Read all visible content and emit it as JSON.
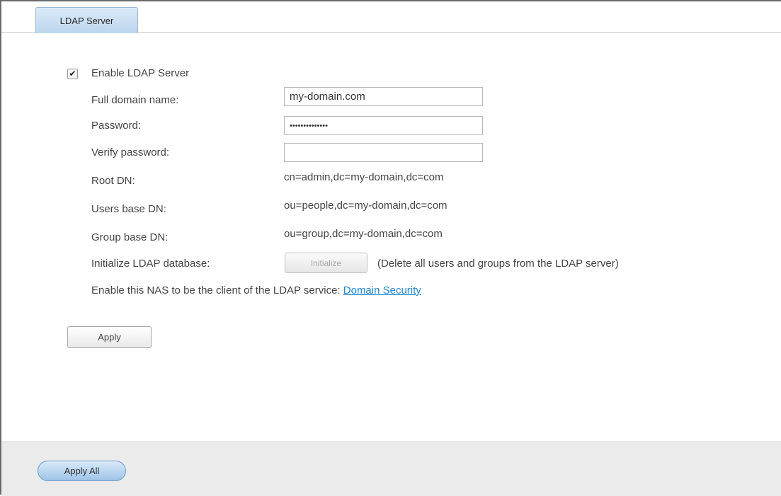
{
  "tabs": [
    {
      "label": "LDAP Server",
      "active": true
    }
  ],
  "form": {
    "enable": {
      "label": "Enable LDAP Server",
      "checked": true
    },
    "full_domain_name": {
      "label": "Full domain name:",
      "value": "my-domain.com"
    },
    "password": {
      "label": "Password:",
      "value": "••••••••••••••"
    },
    "verify_password": {
      "label": "Verify password:",
      "value": ""
    },
    "root_dn": {
      "label": "Root DN:",
      "value": "cn=admin,dc=my-domain,dc=com"
    },
    "users_base_dn": {
      "label": "Users base DN:",
      "value": "ou=people,dc=my-domain,dc=com"
    },
    "group_base_dn": {
      "label": "Group base DN:",
      "value": "ou=group,dc=my-domain,dc=com"
    },
    "initialize": {
      "label": "Initialize LDAP database:",
      "button": "Initialize",
      "note": "(Delete all users and groups from the LDAP server)"
    },
    "client": {
      "text": "Enable this NAS to be the client of the LDAP service:",
      "link": "Domain Security"
    },
    "apply_button": "Apply"
  },
  "footer": {
    "apply_all_button": "Apply All"
  },
  "colors": {
    "link": "#1f86d0",
    "tab_active": "#bcd6ee",
    "footer_bg": "#ebebeb"
  }
}
